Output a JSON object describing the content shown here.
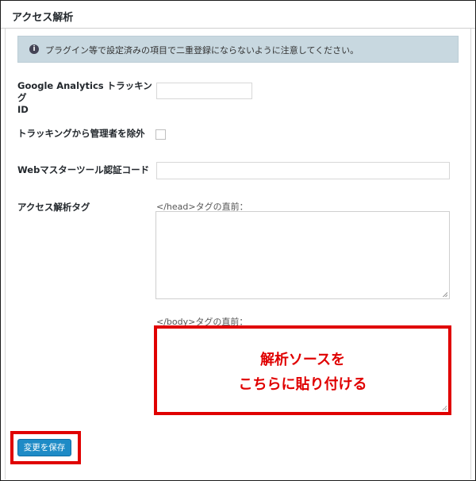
{
  "panel": {
    "title": "アクセス解析"
  },
  "notice": {
    "icon": "info-icon",
    "text": "プラグイン等で設定済みの項目で二重登録にならないように注意してください。"
  },
  "fields": {
    "ga_label_line1": "Google Analytics トラッキング",
    "ga_label_line2": "ID",
    "ga_value": "",
    "exclude_admin_label": "トラッキングから管理者を除外",
    "exclude_admin_checked": false,
    "webmaster_label": "Webマスターツール認証コード",
    "webmaster_value": "",
    "analytics_tag_label": "アクセス解析タグ",
    "head_hint": "</head>タグの直前：",
    "head_value": "",
    "body_hint": "</body>タグの直前："
  },
  "annotation": {
    "line1": "解析ソースを",
    "line2": "こちらに貼り付ける",
    "color": "#e00000"
  },
  "actions": {
    "save_label": "変更を保存"
  },
  "colors": {
    "primary": "#1e8bc6",
    "notice_bg": "#c8d8e0",
    "highlight": "#e00000"
  }
}
